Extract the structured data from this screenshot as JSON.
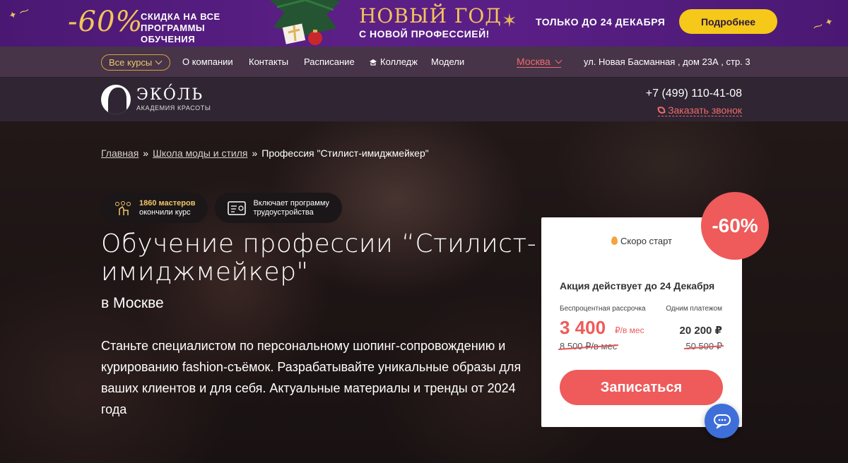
{
  "promo": {
    "discount": "-60%",
    "discount_text": "СКИДКА НА ВСЕ ПРОГРАММЫ ОБУЧЕНИЯ",
    "title": "НОВЫЙ ГОД",
    "subtitle": "С НОВОЙ ПРОФЕССИЕЙ!",
    "until": "ТОЛЬКО ДО 24 ДЕКАБРЯ",
    "button": "Подробнее"
  },
  "nav": {
    "all_courses": "Все курсы",
    "links": [
      "О компании",
      "Контакты",
      "Расписание",
      "Колледж",
      "Модели"
    ],
    "city": "Москва",
    "address": "ул. Новая Басманная , дом 23А , стр. 3"
  },
  "header": {
    "logo_name": "ЭКО́ЛЬ",
    "logo_tag": "АКАДЕМИЯ КРАСОТЫ",
    "phone": "+7 (499) 110-41-08",
    "callback": "Заказать звонок"
  },
  "breadcrumb": {
    "home": "Главная",
    "school": "Школа моды и стиля",
    "current": "Профессия \"Стилист-имиджмейкер\"",
    "separator": "»"
  },
  "badges": [
    {
      "bold": "1860 мастеров",
      "text": "окончили курс",
      "icon": "graduates-icon"
    },
    {
      "bold": "Включает программу",
      "text": "трудоустройства",
      "icon": "certificate-icon"
    }
  ],
  "hero": {
    "title": "Обучение профессии “Стилист-имиджмейкер\"",
    "subtitle": "в Москве",
    "description": "Станьте специалистом по персональному шопинг-сопровождению и курированию fashion-съёмок. Разрабатывайте уникальные образы для ваших клиентов и для себя. Актуальные материалы и тренды от 2024 года"
  },
  "card": {
    "status": "Скоро старт",
    "promo": "Акция действует до 24 Декабря",
    "installment_label": "Беспроцентная рассрочка",
    "onetime_label": "Одним платежом",
    "installment_price": "3 400",
    "installment_unit": "₽/в мес",
    "onetime_price": "20 200 ₽",
    "installment_old": "8 500 ₽/в мес",
    "onetime_old": "50 500 ₽",
    "cta": "Записаться",
    "sale_badge": "-60%"
  },
  "colors": {
    "accent": "#ef5a5a",
    "promo_bg": "#5b1f86",
    "gold": "#f2c45a",
    "chat": "#3e6fd8"
  }
}
